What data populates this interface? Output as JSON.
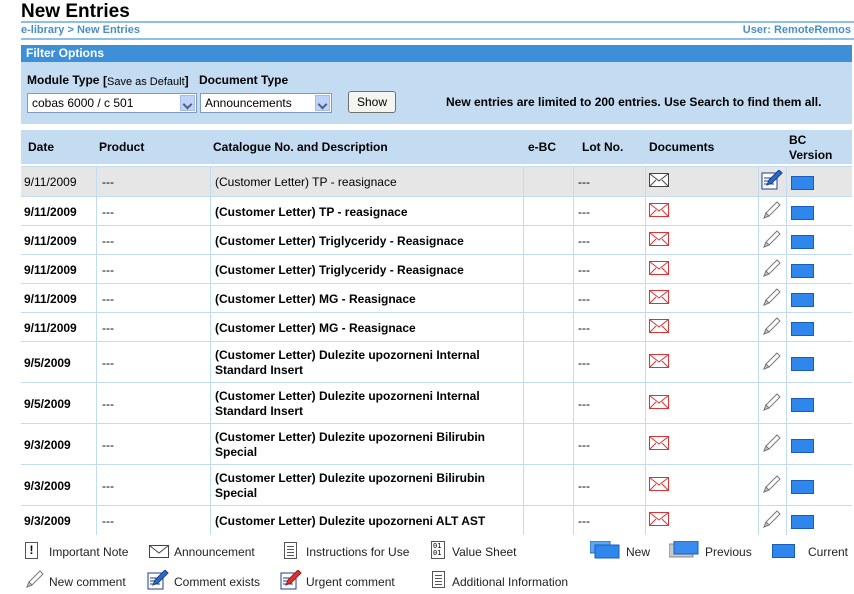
{
  "page": {
    "title": "New Entries",
    "breadcrumb": [
      "e-library",
      "New Entries"
    ],
    "breadcrumb_sep": ">",
    "user_label": "User: RemoteRemos"
  },
  "filter": {
    "header": "Filter Options",
    "module_type_label": "Module Type",
    "save_default_label": "Save as Default",
    "document_type_label": "Document Type",
    "module_type_value": "cobas 6000 / c 501",
    "document_type_value": "Announcements",
    "show_button": "Show",
    "limit_note": "New entries are limited to 200 entries. Use Search to find them all."
  },
  "table": {
    "columns": {
      "date": "Date",
      "product": "Product",
      "catalogue": "Catalogue No. and Description",
      "ebc": "e-BC",
      "lot": "Lot No.",
      "documents": "Documents",
      "bc_version": "BC Version"
    },
    "rows": [
      {
        "date": "9/11/2009",
        "product": "---",
        "desc1": "(Customer Letter) TP - reasignace",
        "desc2": "",
        "lot": "---",
        "highlight": true,
        "comment": "comment-exists",
        "doc": "announcement-read"
      },
      {
        "date": "9/11/2009",
        "product": "---",
        "desc1": "(Customer Letter) TP - reasignace",
        "desc2": "",
        "lot": "---",
        "highlight": false,
        "comment": "new-comment",
        "doc": "announcement-new"
      },
      {
        "date": "9/11/2009",
        "product": "---",
        "desc1": "(Customer Letter) Triglyceridy - Reasignace",
        "desc2": "",
        "lot": "---",
        "highlight": false,
        "comment": "new-comment",
        "doc": "announcement-new"
      },
      {
        "date": "9/11/2009",
        "product": "---",
        "desc1": "(Customer Letter) Triglyceridy - Reasignace",
        "desc2": "",
        "lot": "---",
        "highlight": false,
        "comment": "new-comment",
        "doc": "announcement-new"
      },
      {
        "date": "9/11/2009",
        "product": "---",
        "desc1": "(Customer Letter) MG - Reasignace",
        "desc2": "",
        "lot": "---",
        "highlight": false,
        "comment": "new-comment",
        "doc": "announcement-new"
      },
      {
        "date": "9/11/2009",
        "product": "---",
        "desc1": "(Customer Letter) MG - Reasignace",
        "desc2": "",
        "lot": "---",
        "highlight": false,
        "comment": "new-comment",
        "doc": "announcement-new"
      },
      {
        "date": "9/5/2009",
        "product": "---",
        "desc1": "(Customer Letter) Dulezite upozorneni Internal",
        "desc2": "Standard Insert",
        "lot": "---",
        "highlight": false,
        "comment": "new-comment",
        "doc": "announcement-new"
      },
      {
        "date": "9/5/2009",
        "product": "---",
        "desc1": "(Customer Letter) Dulezite upozorneni Internal",
        "desc2": "Standard Insert",
        "lot": "---",
        "highlight": false,
        "comment": "new-comment",
        "doc": "announcement-new"
      },
      {
        "date": "9/3/2009",
        "product": "---",
        "desc1": "(Customer Letter) Dulezite upozorneni Bilirubin",
        "desc2": "Special",
        "lot": "---",
        "highlight": false,
        "comment": "new-comment",
        "doc": "announcement-new"
      },
      {
        "date": "9/3/2009",
        "product": "---",
        "desc1": "(Customer Letter) Dulezite upozorneni Bilirubin",
        "desc2": "Special",
        "lot": "---",
        "highlight": false,
        "comment": "new-comment",
        "doc": "announcement-new"
      },
      {
        "date": "9/3/2009",
        "product": "---",
        "desc1": "(Customer Letter) Dulezite upozorneni ALT AST",
        "desc2": "",
        "lot": "---",
        "highlight": false,
        "comment": "new-comment",
        "doc": "announcement-new"
      }
    ]
  },
  "legend": {
    "important_note": "Important Note",
    "announcement": "Announcement",
    "instructions": "Instructions for Use",
    "value_sheet": "Value Sheet",
    "new": "New",
    "previous": "Previous",
    "current": "Current",
    "new_comment": "New comment",
    "comment_exists": "Comment exists",
    "urgent_comment": "Urgent comment",
    "additional_info": "Additional Information"
  },
  "colors": {
    "header_blue": "#3d8fd8",
    "panel_blue": "#c4dcf2",
    "link_blue": "#4a8ec8",
    "envelope_red": "#dd3333"
  }
}
